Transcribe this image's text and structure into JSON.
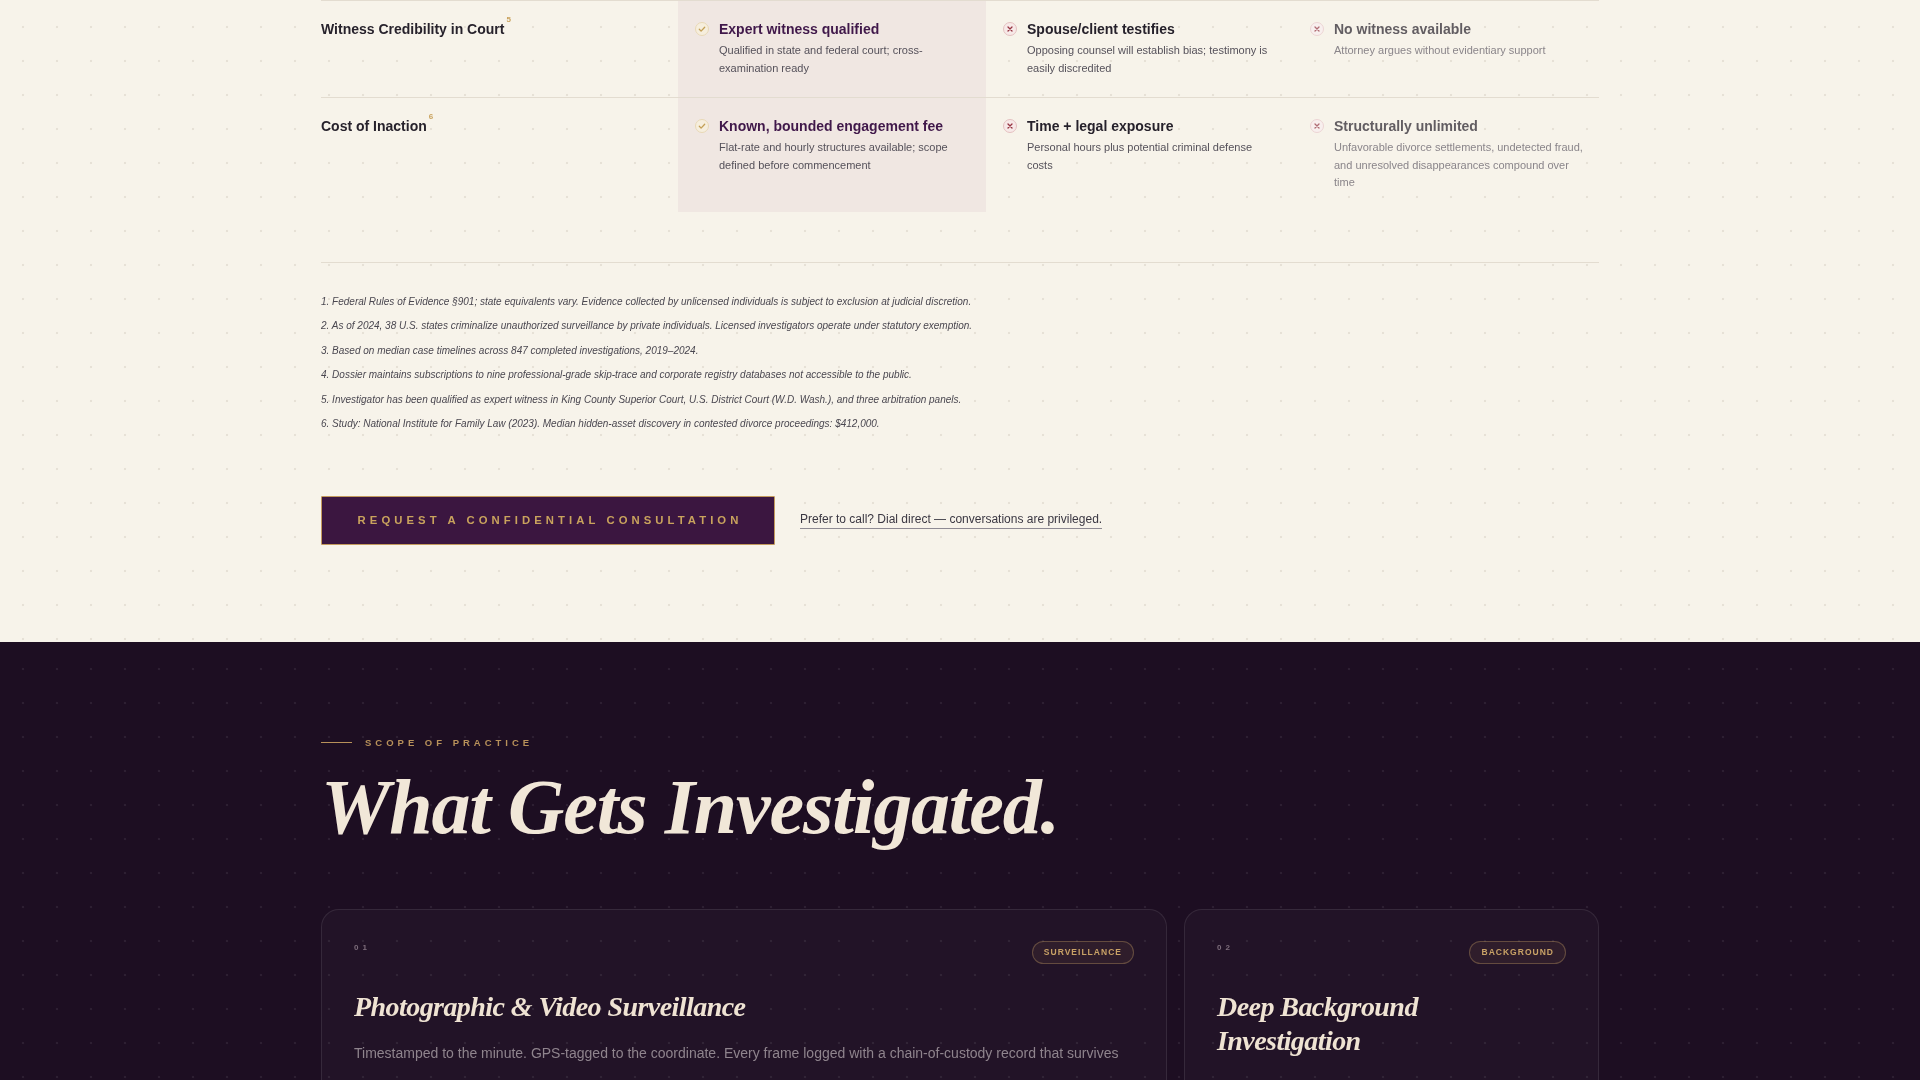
{
  "comparison": {
    "rows": [
      {
        "label": "Witness Credibility in Court$^{5}$",
        "cells": [
          {
            "kind": "check",
            "highlighted": true,
            "muted": false,
            "title": "Expert witness qualified",
            "detail": "Qualified in state and federal court; cross-examination ready"
          },
          {
            "kind": "cross",
            "highlighted": false,
            "muted": false,
            "title": "Spouse/client testifies",
            "detail": "Opposing counsel will establish bias; testimony is easily discredited"
          },
          {
            "kind": "cross",
            "highlighted": false,
            "muted": true,
            "title": "No witness available",
            "detail": "Attorney argues without evidentiary support"
          }
        ]
      },
      {
        "label": "Cost of Inaction$^{6}$",
        "cells": [
          {
            "kind": "check",
            "highlighted": true,
            "muted": false,
            "title": "Known, bounded engagement fee",
            "detail": "Flat-rate and hourly structures available; scope defined before commencement"
          },
          {
            "kind": "cross",
            "highlighted": false,
            "muted": false,
            "title": "Time + legal exposure",
            "detail": "Personal hours plus potential criminal defense costs"
          },
          {
            "kind": "cross",
            "highlighted": false,
            "muted": true,
            "title": "Structurally unlimited",
            "detail": "Unfavorable divorce settlements, undetected fraud, and unresolved disappearances compound over time"
          }
        ]
      }
    ]
  },
  "footnotes": [
    "1. Federal Rules of Evidence §901; state equivalents vary. Evidence collected by unlicensed individuals is subject to exclusion at judicial discretion.",
    "2. As of 2024, 38 U.S. states criminalize unauthorized surveillance by private individuals. Licensed investigators operate under statutory exemption.",
    "3. Based on median case timelines across 847 completed investigations, 2019–2024.",
    "4. Dossier maintains subscriptions to nine professional-grade skip-trace and corporate registry databases not accessible to the public.",
    "5. Investigator has been qualified as expert witness in King County Superior Court, U.S. District Court (W.D. Wash.), and three arbitration panels.",
    "6. Study: National Institute for Family Law (2023). Median hidden-asset discovery in contested divorce proceedings: $412,000."
  ],
  "cta": {
    "button": "REQUEST A CONFIDENTIAL CONSULTATION",
    "link": "Prefer to call? Dial direct — conversations are privileged."
  },
  "scope": {
    "eyebrow": "SCOPE OF PRACTICE",
    "heading": "What Gets Investigated.",
    "cards": [
      {
        "number": "01",
        "tag": "SURVEILLANCE",
        "title": "Photographic & Video Surveillance",
        "description": "Timestamped to the minute. GPS-tagged to the coordinate. Every frame logged with a chain-of-custody record that survives"
      },
      {
        "number": "02",
        "tag": "BACKGROUND",
        "title": "Deep Background Investigation"
      }
    ]
  }
}
